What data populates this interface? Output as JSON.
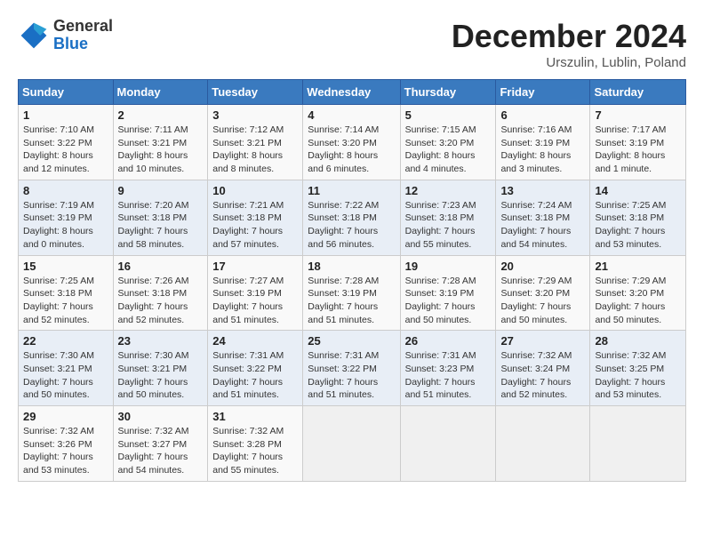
{
  "header": {
    "logo_general": "General",
    "logo_blue": "Blue",
    "month_title": "December 2024",
    "location": "Urszulin, Lublin, Poland"
  },
  "weekdays": [
    "Sunday",
    "Monday",
    "Tuesday",
    "Wednesday",
    "Thursday",
    "Friday",
    "Saturday"
  ],
  "weeks": [
    [
      {
        "day": "1",
        "info": "Sunrise: 7:10 AM\nSunset: 3:22 PM\nDaylight: 8 hours\nand 12 minutes."
      },
      {
        "day": "2",
        "info": "Sunrise: 7:11 AM\nSunset: 3:21 PM\nDaylight: 8 hours\nand 10 minutes."
      },
      {
        "day": "3",
        "info": "Sunrise: 7:12 AM\nSunset: 3:21 PM\nDaylight: 8 hours\nand 8 minutes."
      },
      {
        "day": "4",
        "info": "Sunrise: 7:14 AM\nSunset: 3:20 PM\nDaylight: 8 hours\nand 6 minutes."
      },
      {
        "day": "5",
        "info": "Sunrise: 7:15 AM\nSunset: 3:20 PM\nDaylight: 8 hours\nand 4 minutes."
      },
      {
        "day": "6",
        "info": "Sunrise: 7:16 AM\nSunset: 3:19 PM\nDaylight: 8 hours\nand 3 minutes."
      },
      {
        "day": "7",
        "info": "Sunrise: 7:17 AM\nSunset: 3:19 PM\nDaylight: 8 hours\nand 1 minute."
      }
    ],
    [
      {
        "day": "8",
        "info": "Sunrise: 7:19 AM\nSunset: 3:19 PM\nDaylight: 8 hours\nand 0 minutes."
      },
      {
        "day": "9",
        "info": "Sunrise: 7:20 AM\nSunset: 3:18 PM\nDaylight: 7 hours\nand 58 minutes."
      },
      {
        "day": "10",
        "info": "Sunrise: 7:21 AM\nSunset: 3:18 PM\nDaylight: 7 hours\nand 57 minutes."
      },
      {
        "day": "11",
        "info": "Sunrise: 7:22 AM\nSunset: 3:18 PM\nDaylight: 7 hours\nand 56 minutes."
      },
      {
        "day": "12",
        "info": "Sunrise: 7:23 AM\nSunset: 3:18 PM\nDaylight: 7 hours\nand 55 minutes."
      },
      {
        "day": "13",
        "info": "Sunrise: 7:24 AM\nSunset: 3:18 PM\nDaylight: 7 hours\nand 54 minutes."
      },
      {
        "day": "14",
        "info": "Sunrise: 7:25 AM\nSunset: 3:18 PM\nDaylight: 7 hours\nand 53 minutes."
      }
    ],
    [
      {
        "day": "15",
        "info": "Sunrise: 7:25 AM\nSunset: 3:18 PM\nDaylight: 7 hours\nand 52 minutes."
      },
      {
        "day": "16",
        "info": "Sunrise: 7:26 AM\nSunset: 3:18 PM\nDaylight: 7 hours\nand 52 minutes."
      },
      {
        "day": "17",
        "info": "Sunrise: 7:27 AM\nSunset: 3:19 PM\nDaylight: 7 hours\nand 51 minutes."
      },
      {
        "day": "18",
        "info": "Sunrise: 7:28 AM\nSunset: 3:19 PM\nDaylight: 7 hours\nand 51 minutes."
      },
      {
        "day": "19",
        "info": "Sunrise: 7:28 AM\nSunset: 3:19 PM\nDaylight: 7 hours\nand 50 minutes."
      },
      {
        "day": "20",
        "info": "Sunrise: 7:29 AM\nSunset: 3:20 PM\nDaylight: 7 hours\nand 50 minutes."
      },
      {
        "day": "21",
        "info": "Sunrise: 7:29 AM\nSunset: 3:20 PM\nDaylight: 7 hours\nand 50 minutes."
      }
    ],
    [
      {
        "day": "22",
        "info": "Sunrise: 7:30 AM\nSunset: 3:21 PM\nDaylight: 7 hours\nand 50 minutes."
      },
      {
        "day": "23",
        "info": "Sunrise: 7:30 AM\nSunset: 3:21 PM\nDaylight: 7 hours\nand 50 minutes."
      },
      {
        "day": "24",
        "info": "Sunrise: 7:31 AM\nSunset: 3:22 PM\nDaylight: 7 hours\nand 51 minutes."
      },
      {
        "day": "25",
        "info": "Sunrise: 7:31 AM\nSunset: 3:22 PM\nDaylight: 7 hours\nand 51 minutes."
      },
      {
        "day": "26",
        "info": "Sunrise: 7:31 AM\nSunset: 3:23 PM\nDaylight: 7 hours\nand 51 minutes."
      },
      {
        "day": "27",
        "info": "Sunrise: 7:32 AM\nSunset: 3:24 PM\nDaylight: 7 hours\nand 52 minutes."
      },
      {
        "day": "28",
        "info": "Sunrise: 7:32 AM\nSunset: 3:25 PM\nDaylight: 7 hours\nand 53 minutes."
      }
    ],
    [
      {
        "day": "29",
        "info": "Sunrise: 7:32 AM\nSunset: 3:26 PM\nDaylight: 7 hours\nand 53 minutes."
      },
      {
        "day": "30",
        "info": "Sunrise: 7:32 AM\nSunset: 3:27 PM\nDaylight: 7 hours\nand 54 minutes."
      },
      {
        "day": "31",
        "info": "Sunrise: 7:32 AM\nSunset: 3:28 PM\nDaylight: 7 hours\nand 55 minutes."
      },
      null,
      null,
      null,
      null
    ]
  ]
}
